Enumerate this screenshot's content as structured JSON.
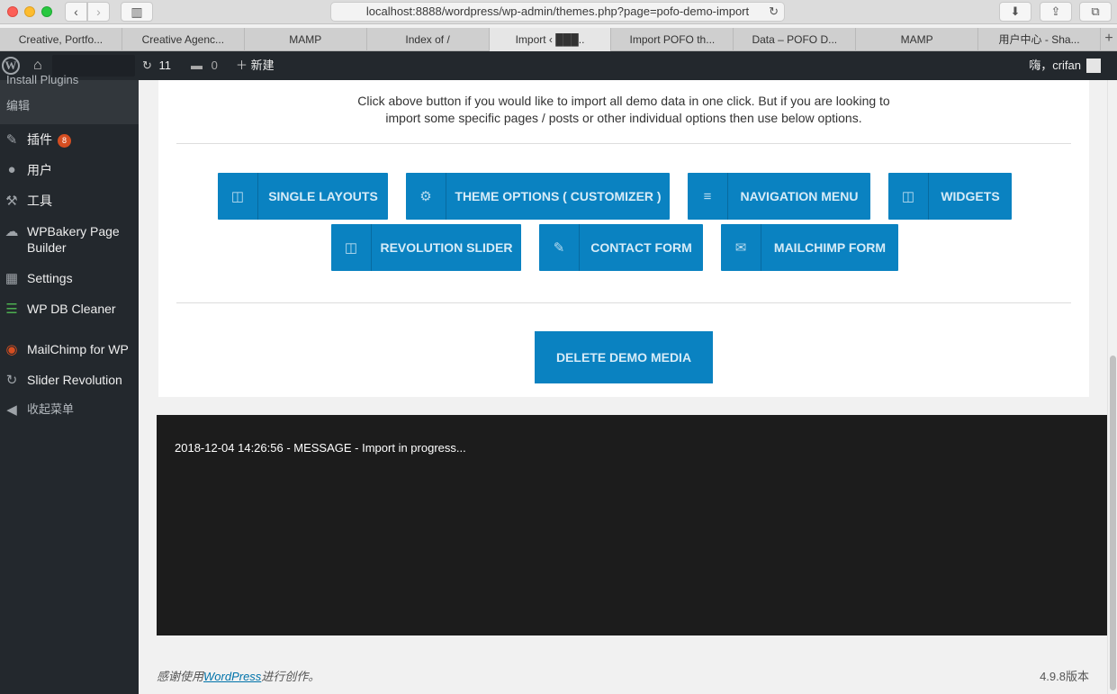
{
  "browser": {
    "url": "localhost:8888/wordpress/wp-admin/themes.php?page=pofo-demo-import",
    "tabs": [
      {
        "label": "Creative, Portfo..."
      },
      {
        "label": "Creative Agenc..."
      },
      {
        "label": "MAMP"
      },
      {
        "label": "Index of /"
      },
      {
        "label": "Import ‹ ███.."
      },
      {
        "label": "Import POFO th..."
      },
      {
        "label": "Data – POFO D..."
      },
      {
        "label": "MAMP"
      },
      {
        "label": "用户中心 - Sha..."
      }
    ],
    "active_tab_index": 4
  },
  "adminbar": {
    "updates_count": "11",
    "comments_count": "0",
    "new_label": "新建",
    "howdy": "嗨，crifan"
  },
  "sidebar": {
    "submenu": [
      {
        "label": "Install Plugins"
      },
      {
        "label": "编辑"
      }
    ],
    "items": [
      {
        "label": "插件",
        "icon": "plugin-icon",
        "badge": "8"
      },
      {
        "label": "用户",
        "icon": "user-icon"
      },
      {
        "label": "工具",
        "icon": "wrench-icon"
      },
      {
        "label": "WPBakery Page Builder",
        "icon": "cloud-icon"
      },
      {
        "label": "Settings",
        "icon": "settings-icon"
      },
      {
        "label": "WP DB Cleaner",
        "icon": "database-icon"
      },
      {
        "label": "MailChimp for WP",
        "icon": "mailchimp-icon"
      },
      {
        "label": "Slider Revolution",
        "icon": "refresh-icon"
      },
      {
        "label": "收起菜单",
        "icon": "collapse-icon"
      }
    ]
  },
  "main": {
    "intro": "Click above button if you would like to import all demo data in one click. But if you are looking to import some specific pages / posts or other individual options then use below options.",
    "buttons": [
      {
        "label": "SINGLE LAYOUTS",
        "icon": "layout-icon"
      },
      {
        "label": "THEME OPTIONS ( CUSTOMIZER )",
        "icon": "gear-icon"
      },
      {
        "label": "NAVIGATION MENU",
        "icon": "menu-icon"
      },
      {
        "label": "WIDGETS",
        "icon": "layout-icon"
      },
      {
        "label": "REVOLUTION SLIDER",
        "icon": "layout-icon"
      },
      {
        "label": "CONTACT FORM",
        "icon": "edit-icon"
      },
      {
        "label": "MAILCHIMP FORM",
        "icon": "envelope-icon"
      }
    ],
    "delete_label": "DELETE DEMO MEDIA",
    "console_message": "2018-12-04 14:26:56 - MESSAGE - Import in progress..."
  },
  "footer": {
    "thanks_prefix": "感谢使用",
    "wordpress_link": "WordPress",
    "thanks_suffix": "进行创作。",
    "version": "4.9.8版本"
  },
  "colors": {
    "button_bg": "#0a82c1",
    "adminbar_bg": "#23282d",
    "badge_bg": "#d54e21",
    "console_bg": "#1c1c1c"
  }
}
